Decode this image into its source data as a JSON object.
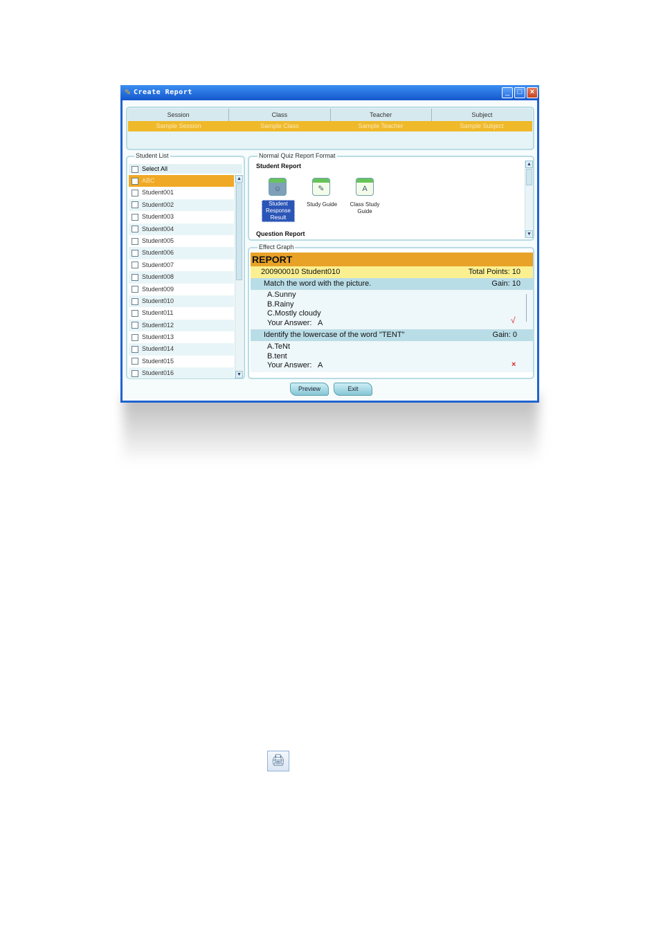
{
  "window": {
    "title": "Create Report",
    "buttons": {
      "minimize": "_",
      "maximize": "□",
      "close": "×"
    }
  },
  "info": {
    "headers": [
      "Session",
      "Class",
      "Teacher",
      "Subject"
    ],
    "values": [
      "Sample Session",
      "Sample Class",
      "Sample Teacher",
      "Sample Subject"
    ]
  },
  "student_list": {
    "legend": "Student List",
    "select_all": "Select All",
    "students": [
      "ABC",
      "Student001",
      "Student002",
      "Student003",
      "Student004",
      "Student005",
      "Student006",
      "Student007",
      "Student008",
      "Student009",
      "Student010",
      "Student011",
      "Student012",
      "Student013",
      "Student014",
      "Student015",
      "Student016"
    ],
    "selected": "ABC"
  },
  "format": {
    "legend": "Normal Quiz Report Format",
    "student_report": "Student Report",
    "question_report": "Question Report",
    "items": [
      {
        "label_lines": [
          "Student",
          "Response",
          "Result"
        ],
        "icon": "student-response-icon",
        "selected": true
      },
      {
        "label_lines": [
          "Study Guide"
        ],
        "icon": "study-guide-icon",
        "selected": false
      },
      {
        "label_lines": [
          "Class Study",
          "Guide"
        ],
        "icon": "class-study-guide-icon",
        "selected": false
      }
    ]
  },
  "effect": {
    "legend": "Effect Graph",
    "report_title": "REPORT",
    "student": "200900010 Student010",
    "total_points": "Total Points: 10",
    "questions": [
      {
        "text": "Match the word with the picture.",
        "gain": "Gain: 10",
        "options": [
          "A.Sunny",
          "B.Rainy",
          "C.Mostly cloudy"
        ],
        "your_answer": "Your Answer:   A",
        "mark": "√"
      },
      {
        "text": "Identify the lowercase of the word \"TENT\"",
        "gain": "Gain: 0",
        "options": [
          "A.TeNt",
          "B.tent"
        ],
        "your_answer": "Your Answer:   A",
        "mark": "×"
      }
    ]
  },
  "actions": {
    "preview": "Preview",
    "exit": "Exit"
  },
  "accent_colors": {
    "titlebar": "#1f63cf",
    "highlight": "#efb92a",
    "panel_border": "#b9dce4",
    "selected_icon": "#2b55b7"
  },
  "standalone_icon": "printer-icon"
}
